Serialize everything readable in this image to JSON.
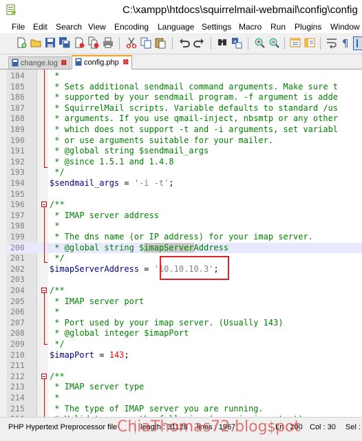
{
  "window": {
    "title": "C:\\xampp\\htdocs\\squirrelmail-webmail\\config\\config"
  },
  "menu": [
    "File",
    "Edit",
    "Search",
    "View",
    "Encoding",
    "Language",
    "Settings",
    "Macro",
    "Run",
    "Plugins",
    "Window"
  ],
  "tabs": [
    {
      "label": "change.log",
      "active": false
    },
    {
      "label": "config.php",
      "active": true
    }
  ],
  "toolbar": {
    "icons": [
      "new-file-icon",
      "open-file-icon",
      "save-icon",
      "save-all-icon",
      "close-icon",
      "close-all-icon",
      "print-icon",
      "cut-icon",
      "copy-icon",
      "paste-icon",
      "undo-icon",
      "redo-icon",
      "find-icon",
      "replace-icon",
      "zoom-in-icon",
      "zoom-out-icon",
      "sync-v-icon",
      "sync-h-icon",
      "wrap-icon",
      "show-all-icon",
      "indent-guide-icon"
    ]
  },
  "editor": {
    "current_line": "200",
    "lines": [
      {
        "n": "184",
        "text": " *"
      },
      {
        "n": "185",
        "text": " * Sets additional sendmail command arguments. Make sure t"
      },
      {
        "n": "186",
        "text": " * supported by your sendmail program. -f argument is adde"
      },
      {
        "n": "187",
        "text": " * SquirrelMail scripts. Variable defaults to standard /us"
      },
      {
        "n": "188",
        "text": " * arguments. If you use qmail-inject, nbsmtp or any other"
      },
      {
        "n": "189",
        "text": " * which does not support -t and -i arguments, set variabl"
      },
      {
        "n": "190",
        "text": " * or use arguments suitable for your mailer."
      },
      {
        "n": "191",
        "text": " * @global string $sendmail_args"
      },
      {
        "n": "192",
        "text": " * @since 1.5.1 and 1.4.8"
      },
      {
        "n": "193",
        "text": " */"
      },
      {
        "n": "194",
        "var": "$sendmail_args",
        "op": " = ",
        "str": "'-i -t'",
        "end": ";"
      },
      {
        "n": "195",
        "text": ""
      },
      {
        "n": "196",
        "text": "/**"
      },
      {
        "n": "197",
        "text": " * IMAP server address"
      },
      {
        "n": "198",
        "text": " *"
      },
      {
        "n": "199",
        "text": " * The dns name (or IP address) for your imap server."
      },
      {
        "n": "200",
        "pre": " * @global string $",
        "hl": "imapServer",
        "post": "Address"
      },
      {
        "n": "201",
        "text": " */"
      },
      {
        "n": "202",
        "var": "$imapServerAddress",
        "op": " = ",
        "str": "'10.10.10.3'",
        "end": ";"
      },
      {
        "n": "203",
        "text": ""
      },
      {
        "n": "204",
        "text": "/**"
      },
      {
        "n": "205",
        "text": " * IMAP server port"
      },
      {
        "n": "206",
        "text": " *"
      },
      {
        "n": "207",
        "text": " * Port used by your imap server. (Usually 143)"
      },
      {
        "n": "208",
        "text": " * @global integer $imapPort"
      },
      {
        "n": "209",
        "text": " */"
      },
      {
        "n": "210",
        "var": "$imapPort",
        "op": " = ",
        "num": "143",
        "end": ";"
      },
      {
        "n": "211",
        "text": ""
      },
      {
        "n": "212",
        "text": "/**"
      },
      {
        "n": "213",
        "text": " * IMAP server type"
      },
      {
        "n": "214",
        "text": " *"
      },
      {
        "n": "215",
        "text": " * The type of IMAP server you are running."
      },
      {
        "n": "216",
        "text": " * Valid type are the following (case is important):"
      }
    ]
  },
  "status": {
    "file_type": "PHP Hypertext Preprocessor file",
    "length": "length : 31128",
    "lines": "lines : 1967",
    "ln": "Ln : 200",
    "col": "Col : 30",
    "sel": "Sel :"
  },
  "watermark": "ChiaThomas72.blogspot"
}
